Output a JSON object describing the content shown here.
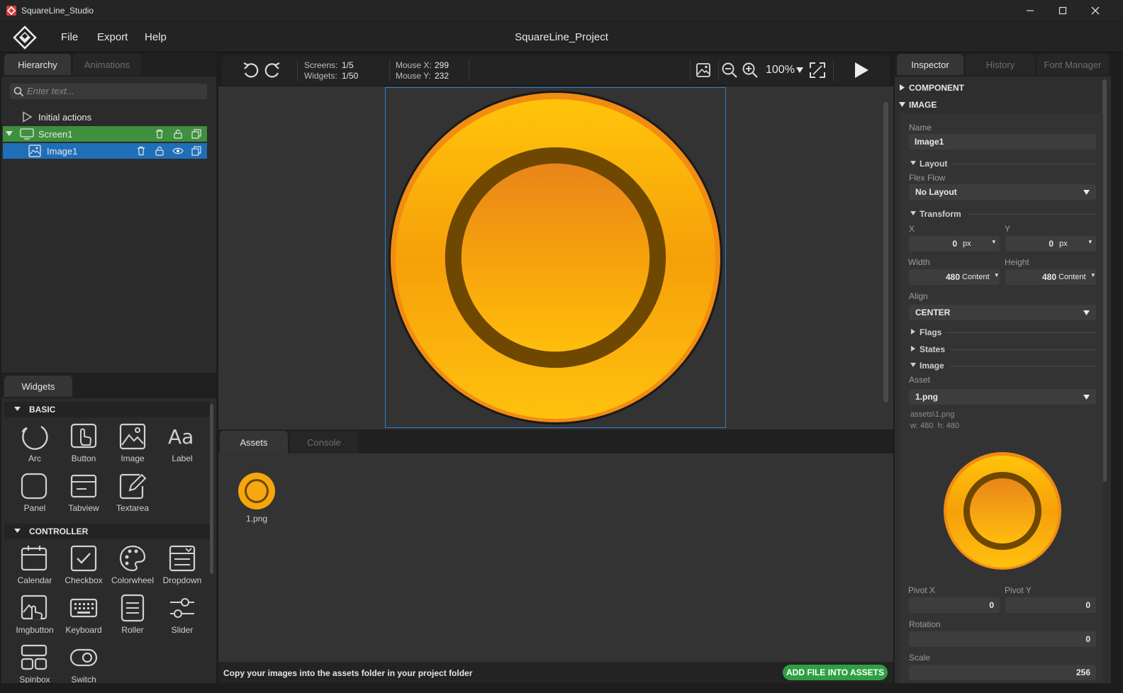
{
  "window": {
    "title": "SquareLine_Studio"
  },
  "menu": {
    "file": "File",
    "export": "Export",
    "help": "Help",
    "project_title": "SquareLine_Project"
  },
  "left_tabs": {
    "hierarchy": "Hierarchy",
    "animations": "Animations"
  },
  "search": {
    "placeholder": "Enter text..."
  },
  "hierarchy": {
    "initial_actions": "Initial actions",
    "screen": "Screen1",
    "image": "Image1"
  },
  "widgets_tab": "Widgets",
  "widgets": {
    "basic_title": "BASIC",
    "basic": [
      "Arc",
      "Button",
      "Image",
      "Label",
      "Panel",
      "Tabview",
      "Textarea"
    ],
    "controller_title": "CONTROLLER",
    "controller": [
      "Calendar",
      "Checkbox",
      "Colorwheel",
      "Dropdown",
      "Imgbutton",
      "Keyboard",
      "Roller",
      "Slider",
      "Spinbox",
      "Switch"
    ]
  },
  "toolbar": {
    "screens_label": "Screens:",
    "screens_value": "1/5",
    "widgets_label": "Widgets:",
    "widgets_value": "1/50",
    "mouse_x_label": "Mouse X:",
    "mouse_x_value": "299",
    "mouse_y_label": "Mouse Y:",
    "mouse_y_value": "232",
    "zoom": "100%"
  },
  "bottom_tabs": {
    "assets": "Assets",
    "console": "Console"
  },
  "asset": {
    "name": "1.png"
  },
  "status": {
    "hint": "Copy your images into the assets folder in your project folder",
    "add_button": "ADD FILE INTO ASSETS"
  },
  "inspector_tabs": {
    "inspector": "Inspector",
    "history": "History",
    "font_manager": "Font Manager"
  },
  "inspector": {
    "component": "COMPONENT",
    "image": "IMAGE",
    "name_label": "Name",
    "name_value": "Image1",
    "layout": "Layout",
    "flex_flow_label": "Flex Flow",
    "flex_flow_value": "No Layout",
    "transform": "Transform",
    "x_label": "X",
    "x_value": "0",
    "x_unit": "px",
    "y_label": "Y",
    "y_value": "0",
    "y_unit": "px",
    "width_label": "Width",
    "width_value": "480",
    "width_unit": "Content",
    "height_label": "Height",
    "height_value": "480",
    "height_unit": "Content",
    "align_label": "Align",
    "align_value": "CENTER",
    "flags": "Flags",
    "states": "States",
    "image_sub": "Image",
    "asset_label": "Asset",
    "asset_value": "1.png",
    "asset_path": "assets\\1.png",
    "asset_size": "w: 480  h: 480",
    "pivot_x_label": "Pivot X",
    "pivot_x_value": "0",
    "pivot_y_label": "Pivot Y",
    "pivot_y_value": "0",
    "rotation_label": "Rotation",
    "rotation_value": "0",
    "scale_label": "Scale",
    "scale_value": "256"
  },
  "colors": {
    "accent_green": "#3e8f3e",
    "accent_blue": "#1f6fb8",
    "coin_orange": "#f6a50c",
    "coin_brown": "#6e4700",
    "button_green": "#2ea043"
  }
}
